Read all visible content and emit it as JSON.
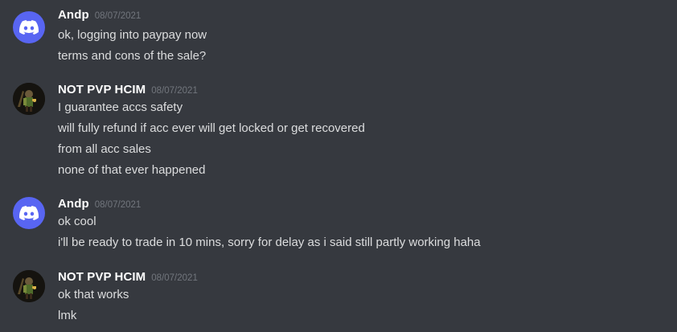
{
  "messages": [
    {
      "username": "Andp",
      "timestamp": "08/07/2021",
      "avatar": "discord-logo-icon",
      "lines": [
        "ok, logging into paypay now",
        "terms and cons of the sale?"
      ]
    },
    {
      "username": "NOT PVP HCIM",
      "timestamp": "08/07/2021",
      "avatar": "game-character-avatar",
      "lines": [
        "I guarantee accs safety",
        "will fully refund if acc ever will get locked or get recovered",
        "from all acc sales",
        "none of that ever happened"
      ]
    },
    {
      "username": "Andp",
      "timestamp": "08/07/2021",
      "avatar": "discord-logo-icon",
      "lines": [
        "ok cool",
        "i'll be ready to trade in 10 mins, sorry for delay as i said still partly working haha"
      ]
    },
    {
      "username": "NOT PVP HCIM",
      "timestamp": "08/07/2021",
      "avatar": "game-character-avatar",
      "lines": [
        "ok that works",
        "lmk"
      ]
    }
  ],
  "colors": {
    "background": "#36393f",
    "username": "#ffffff",
    "timestamp": "#72767d",
    "text": "#dcddde",
    "discord_blurple": "#5865f2"
  }
}
